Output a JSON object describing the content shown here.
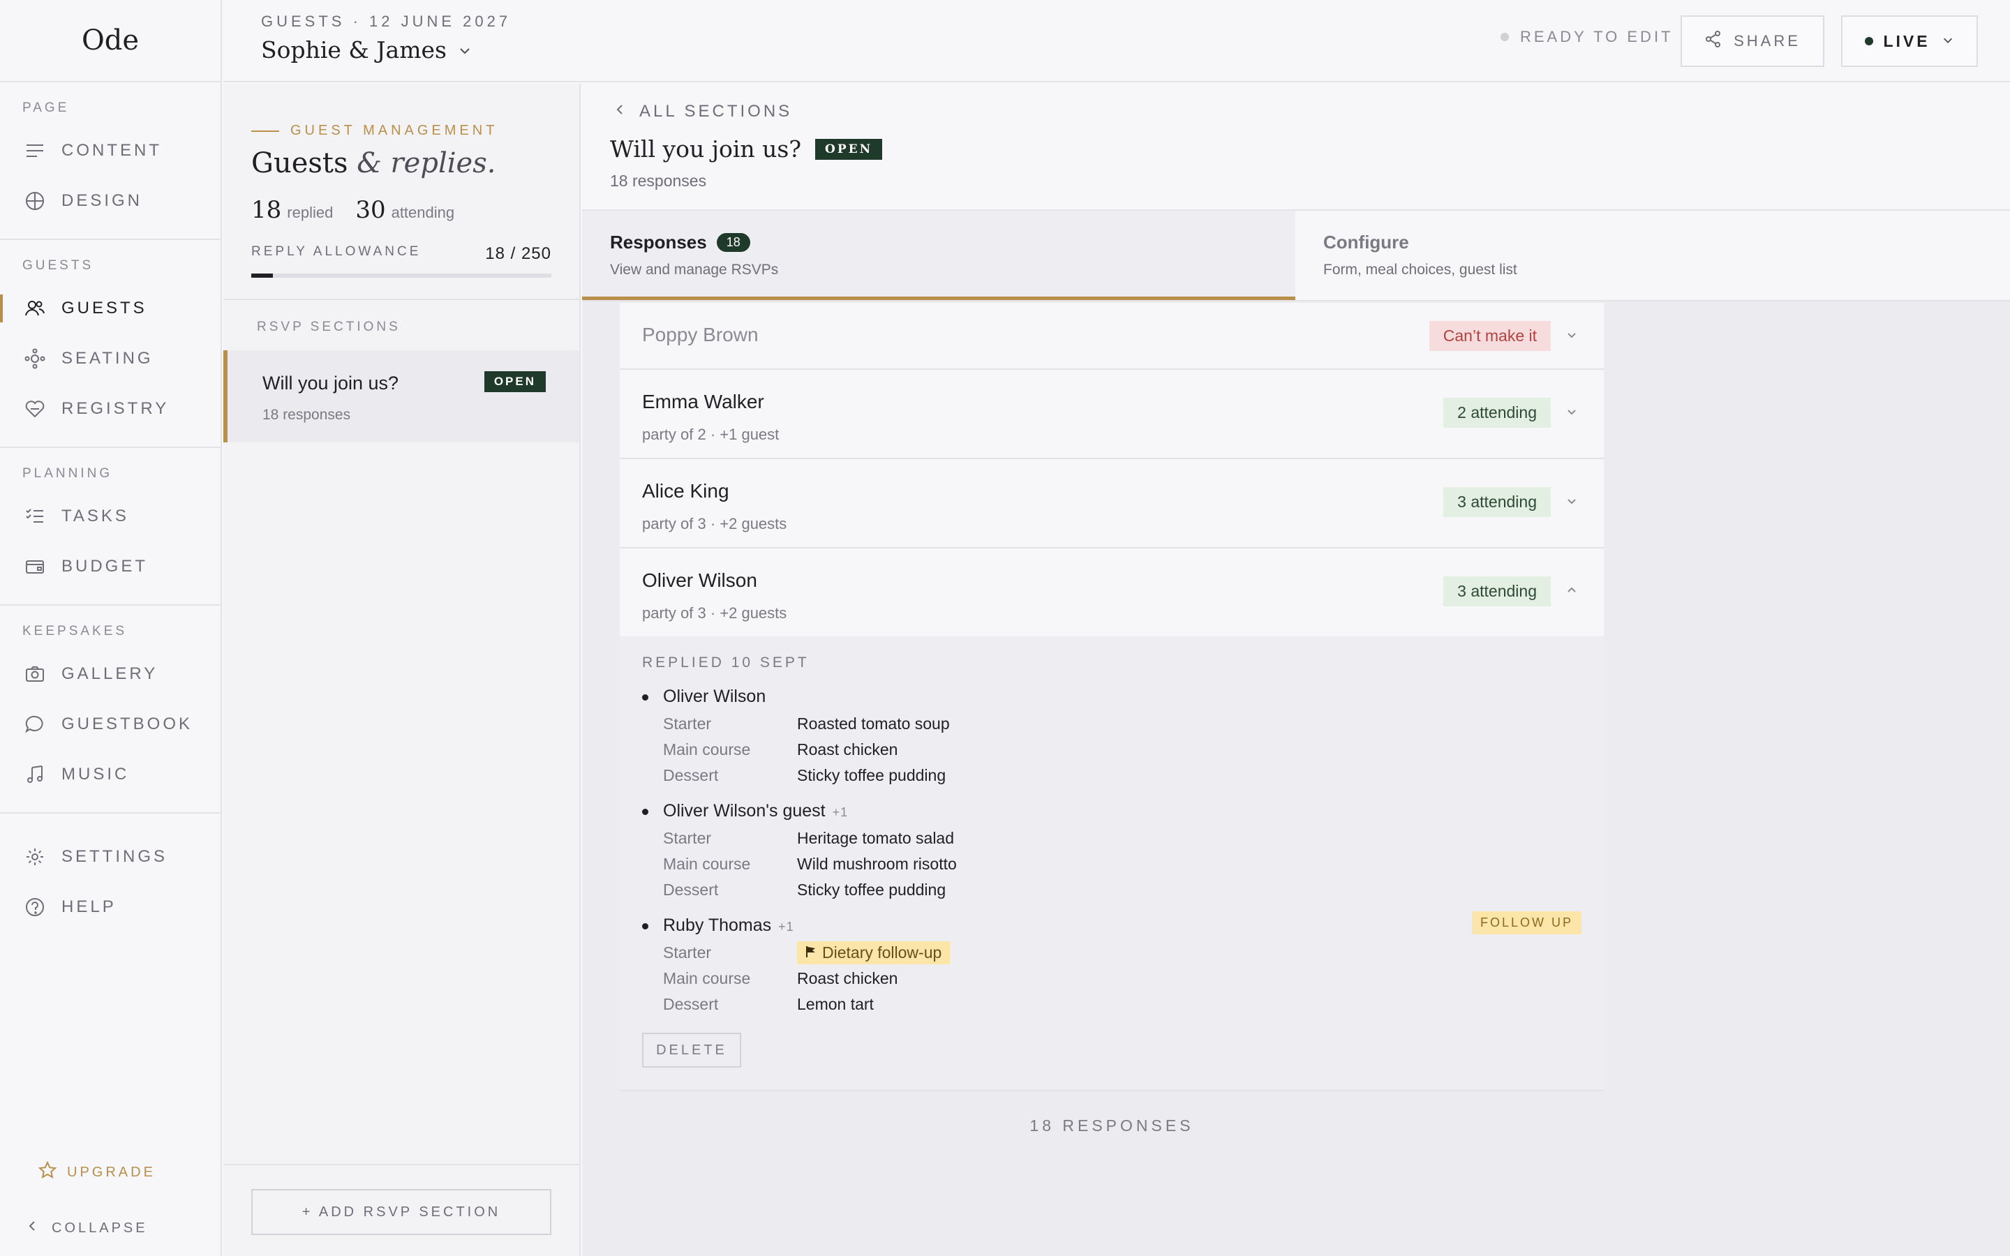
{
  "brand": "Ode",
  "sidebar": {
    "sections": [
      {
        "heading": "PAGE",
        "items": [
          {
            "label": "CONTENT",
            "icon": "lines-icon"
          },
          {
            "label": "DESIGN",
            "icon": "globe-icon"
          }
        ]
      },
      {
        "heading": "GUESTS",
        "items": [
          {
            "label": "GUESTS",
            "icon": "people-icon",
            "active": true
          },
          {
            "label": "SEATING",
            "icon": "seating-icon"
          },
          {
            "label": "REGISTRY",
            "icon": "heart-gift-icon"
          }
        ]
      },
      {
        "heading": "PLANNING",
        "items": [
          {
            "label": "TASKS",
            "icon": "checklist-icon"
          },
          {
            "label": "BUDGET",
            "icon": "wallet-icon"
          }
        ]
      },
      {
        "heading": "KEEPSAKES",
        "items": [
          {
            "label": "GALLERY",
            "icon": "camera-icon"
          },
          {
            "label": "GUESTBOOK",
            "icon": "chat-icon"
          },
          {
            "label": "MUSIC",
            "icon": "music-icon"
          }
        ]
      }
    ],
    "settings": "SETTINGS",
    "help": "HELP",
    "upgrade": "UPGRADE",
    "collapse": "COLLAPSE"
  },
  "header": {
    "crumb": "GUESTS · 12 JUNE 2027",
    "couple": "Sophie & James",
    "status": "READY TO EDIT",
    "share": "SHARE",
    "live": "LIVE"
  },
  "panel": {
    "label": "GUEST MANAGEMENT",
    "title_a": "Guests ",
    "title_b": "& replies.",
    "replied_num": "18",
    "replied_lbl": "replied",
    "attending_num": "30",
    "attending_lbl": "attending",
    "allowance_label": "REPLY ALLOWANCE",
    "allowance_value": "18 / 250",
    "allowance_fraction": 0.072,
    "rsvp_heading": "RSVP SECTIONS",
    "rsvp_item": {
      "title": "Will you join us?",
      "badge": "OPEN",
      "sub": "18 responses"
    },
    "add_button": "+ ADD RSVP SECTION"
  },
  "main": {
    "back": "ALL SECTIONS",
    "title": "Will you join us?",
    "badge": "OPEN",
    "sub": "18 responses",
    "tabs": [
      {
        "label": "Responses",
        "count": "18",
        "sub": "View and manage RSVPs"
      },
      {
        "label": "Configure",
        "sub": "Form, meal choices, guest list"
      }
    ],
    "rows": {
      "poppy": {
        "name": "Poppy Brown",
        "status": "Can’t make it"
      },
      "emma": {
        "name": "Emma Walker",
        "party": "party of 2 · +1 guest",
        "status": "2 attending"
      },
      "alice": {
        "name": "Alice King",
        "party": "party of 3 · +2 guests",
        "status": "3 attending"
      },
      "oliver": {
        "name": "Oliver Wilson",
        "party": "party of 3 · +2 guests",
        "status": "3 attending"
      }
    },
    "detail": {
      "replied": "REPLIED 10 SEPT",
      "labels": {
        "starter": "Starter",
        "main": "Main course",
        "dessert": "Dessert"
      },
      "guests": [
        {
          "name": "Oliver Wilson",
          "starter": "Roasted tomato soup",
          "main": "Roast chicken",
          "dessert": "Sticky toffee pudding"
        },
        {
          "name": "Oliver Wilson's guest",
          "plus": "+1",
          "starter": "Heritage tomato salad",
          "main": "Wild mushroom risotto",
          "dessert": "Sticky toffee pudding"
        },
        {
          "name": "Ruby Thomas",
          "plus": "+1",
          "starter_flag": "Dietary follow-up",
          "main": "Roast chicken",
          "dessert": "Lemon tart",
          "follow": "FOLLOW UP"
        }
      ],
      "delete": "DELETE"
    },
    "footer": "18 RESPONSES"
  }
}
